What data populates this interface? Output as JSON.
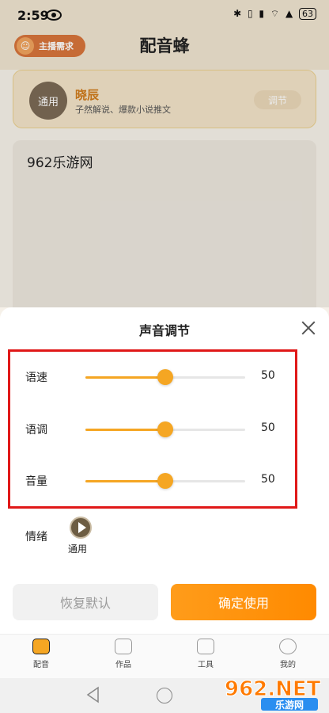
{
  "status_bar": {
    "time": "2:59",
    "icons": "✱ ▯ ▮ ⌔ ▲",
    "battery": "63"
  },
  "header": {
    "anchor_button": "主播需求",
    "title": "配音蜂"
  },
  "voice_card": {
    "avatar_text": "通用",
    "name": "晓辰",
    "description": "子然解说、爆款小说推文",
    "adjust_button": "调节"
  },
  "editor": {
    "text": "962乐游网"
  },
  "sheet": {
    "title": "声音调节",
    "sliders": [
      {
        "label": "语速",
        "value": "50",
        "fraction": 0.5
      },
      {
        "label": "语调",
        "value": "50",
        "fraction": 0.5
      },
      {
        "label": "音量",
        "value": "50",
        "fraction": 0.5
      }
    ],
    "emotion_label": "情绪",
    "emotion_name": "通用",
    "reset_button": "恢复默认",
    "confirm_button": "确定使用"
  },
  "tabs": [
    {
      "label": "配音",
      "icon": "robot-icon",
      "active": true
    },
    {
      "label": "作品",
      "icon": "works-icon",
      "active": false
    },
    {
      "label": "工具",
      "icon": "toolbox-icon",
      "active": false
    },
    {
      "label": "我的",
      "icon": "profile-icon",
      "active": false
    }
  ],
  "watermark": {
    "text1": "962.NET",
    "text2": "乐游网"
  },
  "colors": {
    "accent": "#f5a623",
    "highlight": "#e01818",
    "voice_name": "#d07a1a"
  }
}
